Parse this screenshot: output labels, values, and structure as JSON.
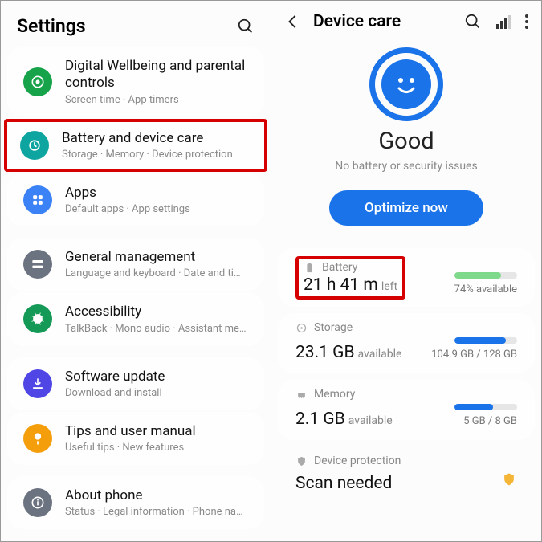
{
  "left": {
    "title": "Settings",
    "items": [
      {
        "label": "Digital Wellbeing and parental controls",
        "sub": "Screen time  ·  App timers",
        "color": "#16a34a"
      },
      {
        "label": "Battery and device care",
        "sub": "Storage  ·  Memory  ·  Device protection",
        "color": "#0ea5a0"
      },
      {
        "label": "Apps",
        "sub": "Default apps  ·  App settings",
        "color": "#3b82f6"
      },
      {
        "label": "General management",
        "sub": "Language and keyboard  ·  Date and time",
        "color": "#6b7280"
      },
      {
        "label": "Accessibility",
        "sub": "TalkBack  ·  Mono audio  ·  Assistant menu",
        "color": "#159957"
      },
      {
        "label": "Software update",
        "sub": "Download and install",
        "color": "#4f46e5"
      },
      {
        "label": "Tips and user manual",
        "sub": "Useful tips  ·  New features",
        "color": "#f59e0b"
      },
      {
        "label": "About phone",
        "sub": "Status  ·  Legal information  ·  Phone name",
        "color": "#6b7280"
      }
    ]
  },
  "right": {
    "title": "Device care",
    "status_title": "Good",
    "status_sub": "No battery or security issues",
    "optimize": "Optimize now",
    "battery": {
      "label": "Battery",
      "value": "21 h 41 m",
      "unit": "left",
      "pct": "74% available",
      "fill": 74,
      "color": "#7fd98a"
    },
    "storage": {
      "label": "Storage",
      "value": "23.1 GB",
      "unit": "available",
      "right": "104.9 GB / 128 GB",
      "fill": 82,
      "color": "#1a73e8"
    },
    "memory": {
      "label": "Memory",
      "value": "2.1 GB",
      "unit": "available",
      "right": "5 GB / 8 GB",
      "fill": 62,
      "color": "#1a73e8"
    },
    "protection": {
      "label": "Device protection",
      "value": "Scan needed"
    }
  }
}
